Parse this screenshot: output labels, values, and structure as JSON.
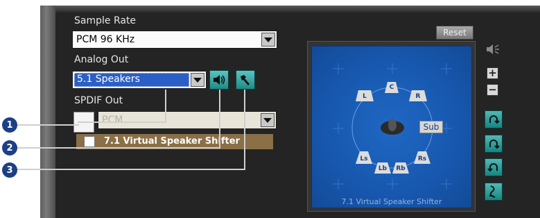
{
  "sample_rate": {
    "label": "Sample Rate",
    "value": "PCM 96 KHz"
  },
  "analog_out": {
    "label": "Analog Out",
    "value": "5.1 Speakers"
  },
  "spdif_out": {
    "label": "SPDIF Out",
    "value": "PCM"
  },
  "virtual_shifter": {
    "label": "7.1 Virtual Speaker Shifter",
    "checked": false
  },
  "reset_label": "Reset",
  "speaker_panel": {
    "caption": "7.1 Virtual Speaker Shifter",
    "speakers": {
      "c": "C",
      "l": "L",
      "r": "R",
      "sub": "Sub",
      "ls": "Ls",
      "rs": "Rs",
      "lb": "Lb",
      "rb": "Rb"
    }
  },
  "callouts": [
    "1",
    "2",
    "3"
  ],
  "icons": {
    "speaker_test": "speaker-test-icon",
    "settings": "hammer-icon",
    "mute": "mute-speaker-icon",
    "volume_up": "plus-icon",
    "volume_down": "minus-icon",
    "rotate_left": "rotate-left-icon",
    "rotate_right": "rotate-right-icon",
    "rotate_mode": "rotate-mode-icon",
    "wave": "wave-icon"
  },
  "colors": {
    "panel_bg": "#242424",
    "selected_blue": "#2b5fc5",
    "teal": "#1f8a86",
    "callout": "#1d3f86",
    "shifter_bar": "#8a6f47"
  }
}
